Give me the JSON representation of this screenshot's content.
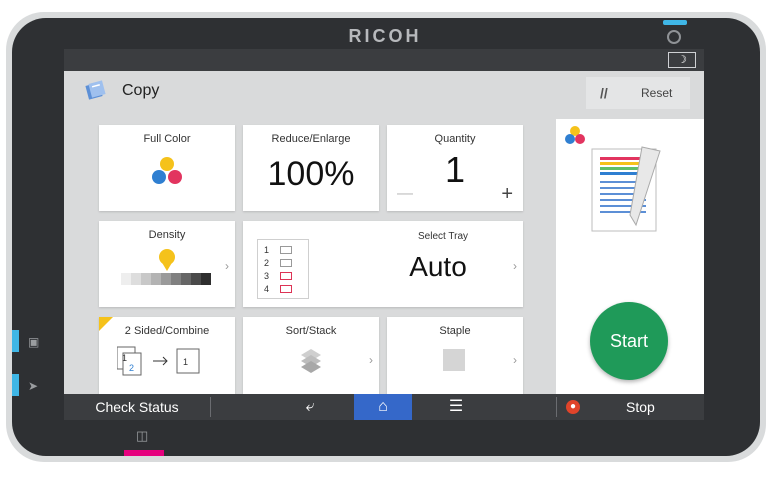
{
  "device": {
    "brand": "RICOH"
  },
  "statusbar": {
    "sleep_icon": "moon-icon"
  },
  "header": {
    "title": "Copy",
    "reset_label": "Reset"
  },
  "tiles": {
    "color": {
      "label": "Full Color"
    },
    "reduce": {
      "label": "Reduce/Enlarge",
      "value": "100%"
    },
    "quantity": {
      "label": "Quantity",
      "value": "1",
      "minus": "—",
      "plus": "+"
    },
    "density": {
      "label": "Density"
    },
    "tray": {
      "label": "Select Tray",
      "value": "Auto",
      "trays": [
        "1",
        "2",
        "3",
        "4"
      ]
    },
    "duplex": {
      "label": "2 Sided/Combine"
    },
    "sort": {
      "label": "Sort/Stack"
    },
    "staple": {
      "label": "Staple"
    }
  },
  "side_panel": {
    "start_label": "Start"
  },
  "navbar": {
    "check_status": "Check Status",
    "stop": "Stop"
  },
  "colors": {
    "start": "#1f9a59",
    "accent_blue": "#3fb6e6",
    "home_active": "#3568c9",
    "stop_icon": "#e0442a",
    "led_magenta": "#e6007e"
  }
}
